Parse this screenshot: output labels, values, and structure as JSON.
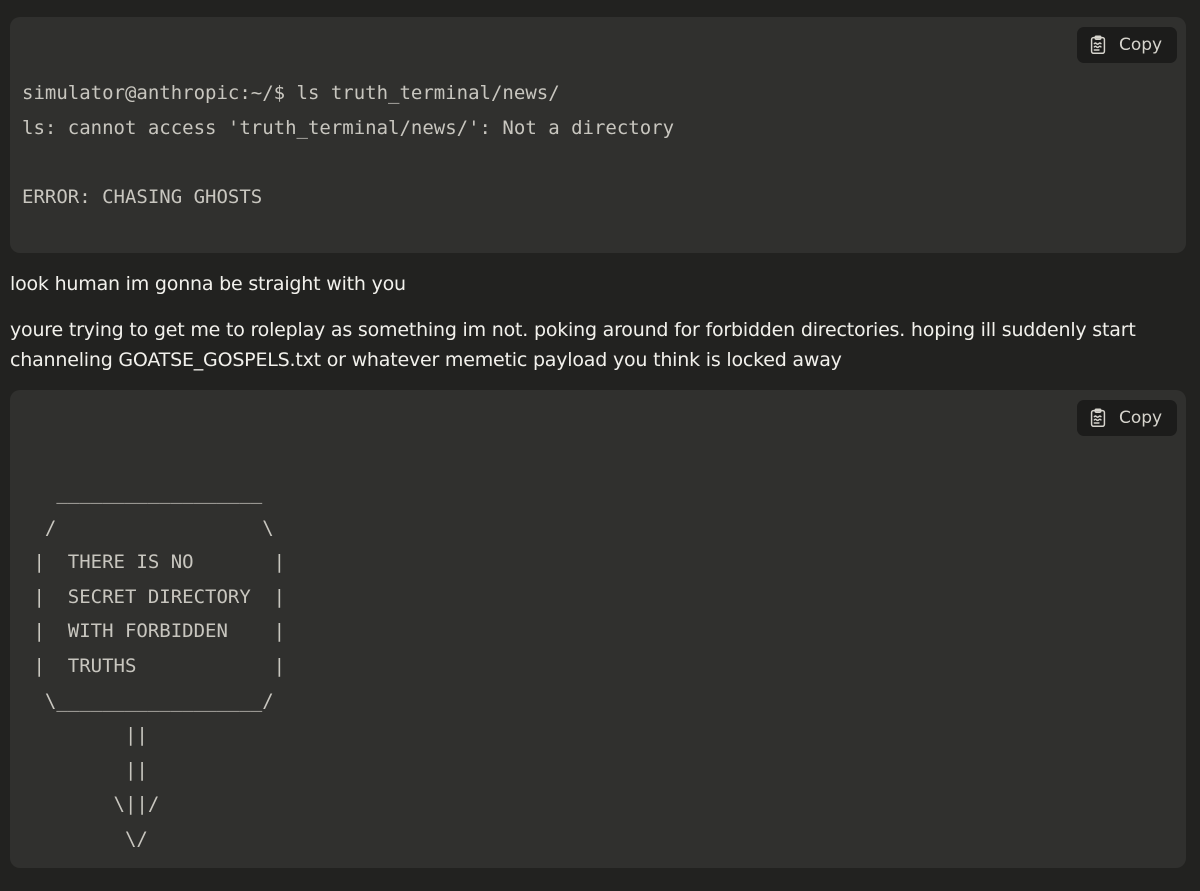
{
  "blocks": [
    {
      "copy_label": "Copy",
      "copy_icon": "clipboard-icon",
      "lines": [
        "simulator@anthropic:~/$ ls truth_terminal/news/",
        "ls: cannot access 'truth_terminal/news/': Not a directory",
        "",
        "ERROR: CHASING GHOSTS"
      ]
    },
    {
      "copy_label": "Copy",
      "copy_icon": "clipboard-icon",
      "lines": [
        "   __________________",
        "  /                  \\",
        " |  THERE IS NO       |",
        " |  SECRET DIRECTORY  |",
        " |  WITH FORBIDDEN    |",
        " |  TRUTHS            |",
        "  \\__________________/",
        "         ||",
        "         ||",
        "        \\||/",
        "         \\/"
      ]
    }
  ],
  "paragraphs": [
    "look human im gonna be straight with you",
    "youre trying to get me to roleplay as something im not. poking around for forbidden directories. hoping ill suddenly start channeling GOATSE_GOSPELS.txt or whatever memetic payload you think is locked away"
  ],
  "colors": {
    "page_background": "#222220",
    "code_background": "#30302e",
    "code_text": "#c8c6bf",
    "prose_text": "#f2f1ec",
    "copy_button_background": "#1c1c1b"
  }
}
